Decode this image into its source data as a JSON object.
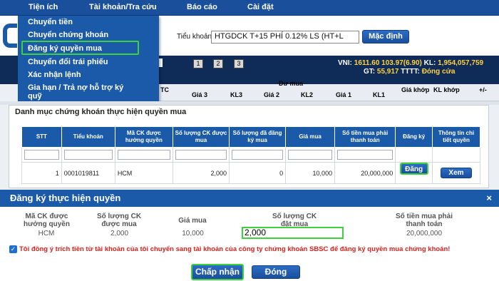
{
  "menu": {
    "items": [
      "Tiện ích",
      "Tài khoản/Tra cứu",
      "Báo cáo",
      "Cài đặt"
    ],
    "dropdown": [
      "Chuyển tiền",
      "Chuyển chứng khoán",
      "Đăng ký quyền mua",
      "Chuyển đổi trái phiếu",
      "Xác nhận lệnh",
      "Gia hạn / Trả nợ hỗ trợ ký",
      "quỹ"
    ]
  },
  "header": {
    "account_label": "Tiểu khoản",
    "account_value": "HTGDCK T+15 PHÍ 0.12% LS (HT+L",
    "default_button": "Mặc định"
  },
  "board": {
    "pages": [
      "1",
      "2",
      "3"
    ],
    "tc": "TC",
    "vni_label": "VNI:",
    "vni_value": "1611.60",
    "vni_change": "103.97(6.90)",
    "kl_label": "KL:",
    "kl_value": "1,954,057,759",
    "gt_label": "GT:",
    "gt_value": "55,917",
    "tttt_label": "TTTT:",
    "tttt_value": "Đóng cửa",
    "du_mua": "Dư mua",
    "cols": [
      "Giá 3",
      "KL3",
      "Giá 2",
      "KL2",
      "Giá 1",
      "KL1"
    ],
    "gia_khop": "Giá khớp",
    "kl_khop": "KL khớp",
    "pm": "+/-"
  },
  "rights": {
    "title": "Danh mục chứng khoán thực hiện quyền mua",
    "headers": [
      "STT",
      "Tiểu khoản",
      "Mã CK được hưởng quyền",
      "Số lượng CK được mua",
      "Số lượng đã đăng ký mua",
      "Giá mua",
      "Số tiền mua phải thanh toán",
      "Đăng ký",
      "Thông tin chi tiết quyền"
    ],
    "row": {
      "stt": "1",
      "account": "0001019811",
      "code": "HCM",
      "qty": "2,000",
      "registered": "0",
      "price": "10,000",
      "amount": "20,000,000",
      "register_button": "Đăng ký",
      "view_button": "Xem"
    }
  },
  "modal": {
    "title": "Đăng ký thực hiện quyền",
    "close": "×",
    "labels": [
      "Mã CK được hưởng quyền",
      "Số lượng CK được mua",
      "Giá mua",
      "Số lượng CK đặt mua",
      "Số tiền mua phải thanh toán"
    ],
    "values": {
      "code": "HCM",
      "qty": "2,000",
      "price": "10,000",
      "order_qty": "2,000",
      "amount": "20,000,000"
    },
    "agree_text": "Tôi đồng ý trích tiền từ tài khoản của tôi chuyển sang tài khoản của công ty chứng khoán SBSC để đăng ký quyền mua chứng khoán!",
    "confirm_button": "Chấp nhận",
    "close_button": "Đóng"
  },
  "colors": {
    "primary": "#1b5aa8",
    "highlight": "#3ed13e",
    "warning": "#e0201a",
    "ticker": "#ffd23e"
  }
}
